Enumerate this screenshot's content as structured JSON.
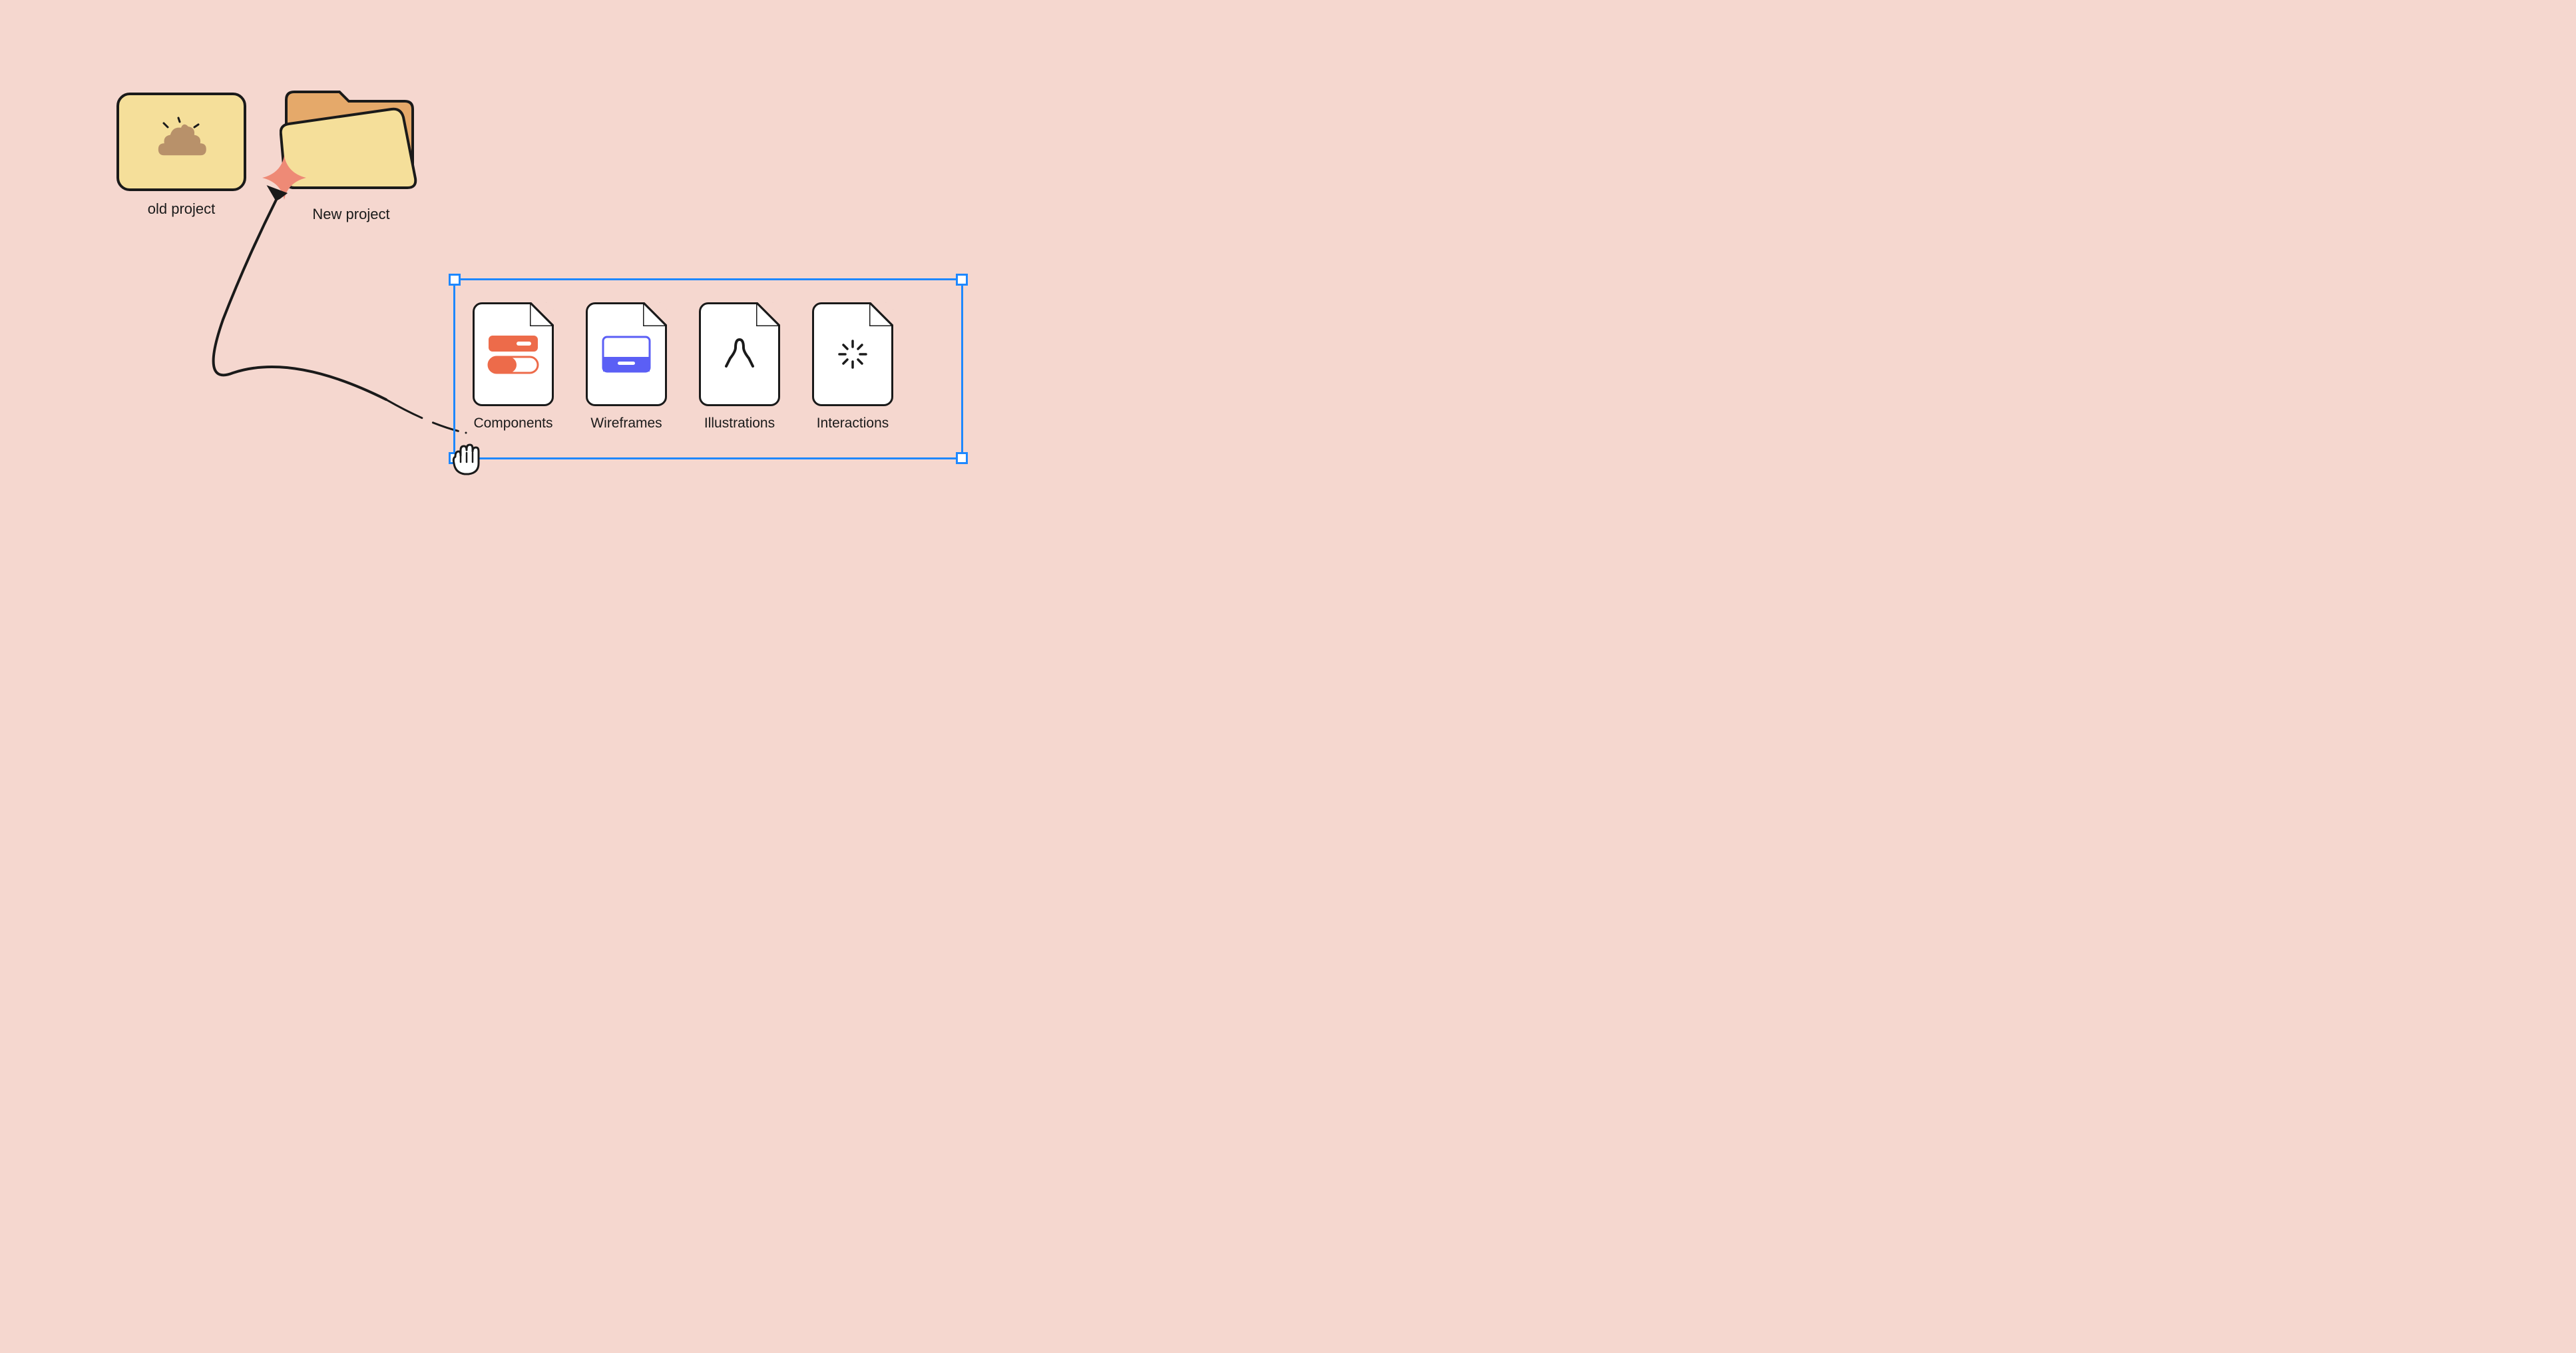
{
  "folders": {
    "old": {
      "label": "old project"
    },
    "new": {
      "label": "New project"
    }
  },
  "files": [
    {
      "label": "Components"
    },
    {
      "label": "Wireframes"
    },
    {
      "label": "Illustrations"
    },
    {
      "label": "Interactions"
    }
  ]
}
